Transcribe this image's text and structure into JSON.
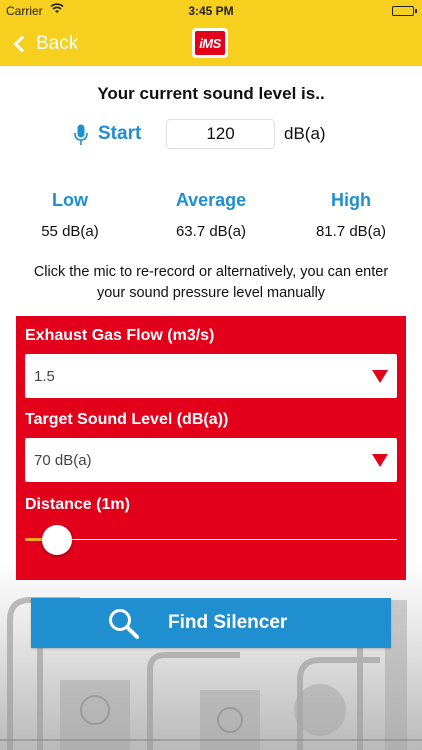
{
  "status_bar": {
    "carrier": "Carrier",
    "time": "3:45 PM",
    "battery_level": 1.0
  },
  "nav": {
    "back_label": "Back",
    "logo_text": "iMS",
    "background": "#f6cf1f"
  },
  "main": {
    "headline": "Your current sound level is..",
    "start_label": "Start",
    "sound_level_value": "120",
    "unit_label": "dB(a)",
    "stats": [
      {
        "label": "Low",
        "value": "55 dB(a)"
      },
      {
        "label": "Average",
        "value": "63.7 dB(a)"
      },
      {
        "label": "High",
        "value": "81.7 dB(a)"
      }
    ],
    "hint_text": "Click the mic to re-record or alternatively, you can enter your sound pressure level manually"
  },
  "form": {
    "background": "#e2001a",
    "exhaust_label": "Exhaust Gas Flow (m3/s)",
    "exhaust_value": "1.5",
    "target_label": "Target Sound Level (dB(a))",
    "target_value": "70 dB(a)",
    "distance_label": "Distance (1m)",
    "distance_slider_fraction": 0.085
  },
  "find_button": {
    "label": "Find Silencer",
    "color": "#1f8fd0",
    "icon": "search-icon"
  },
  "colors": {
    "accent_blue": "#1f8fd0",
    "brand_red": "#e2001a",
    "brand_yellow": "#f6cf1f",
    "slider_fill": "#f6a623"
  }
}
